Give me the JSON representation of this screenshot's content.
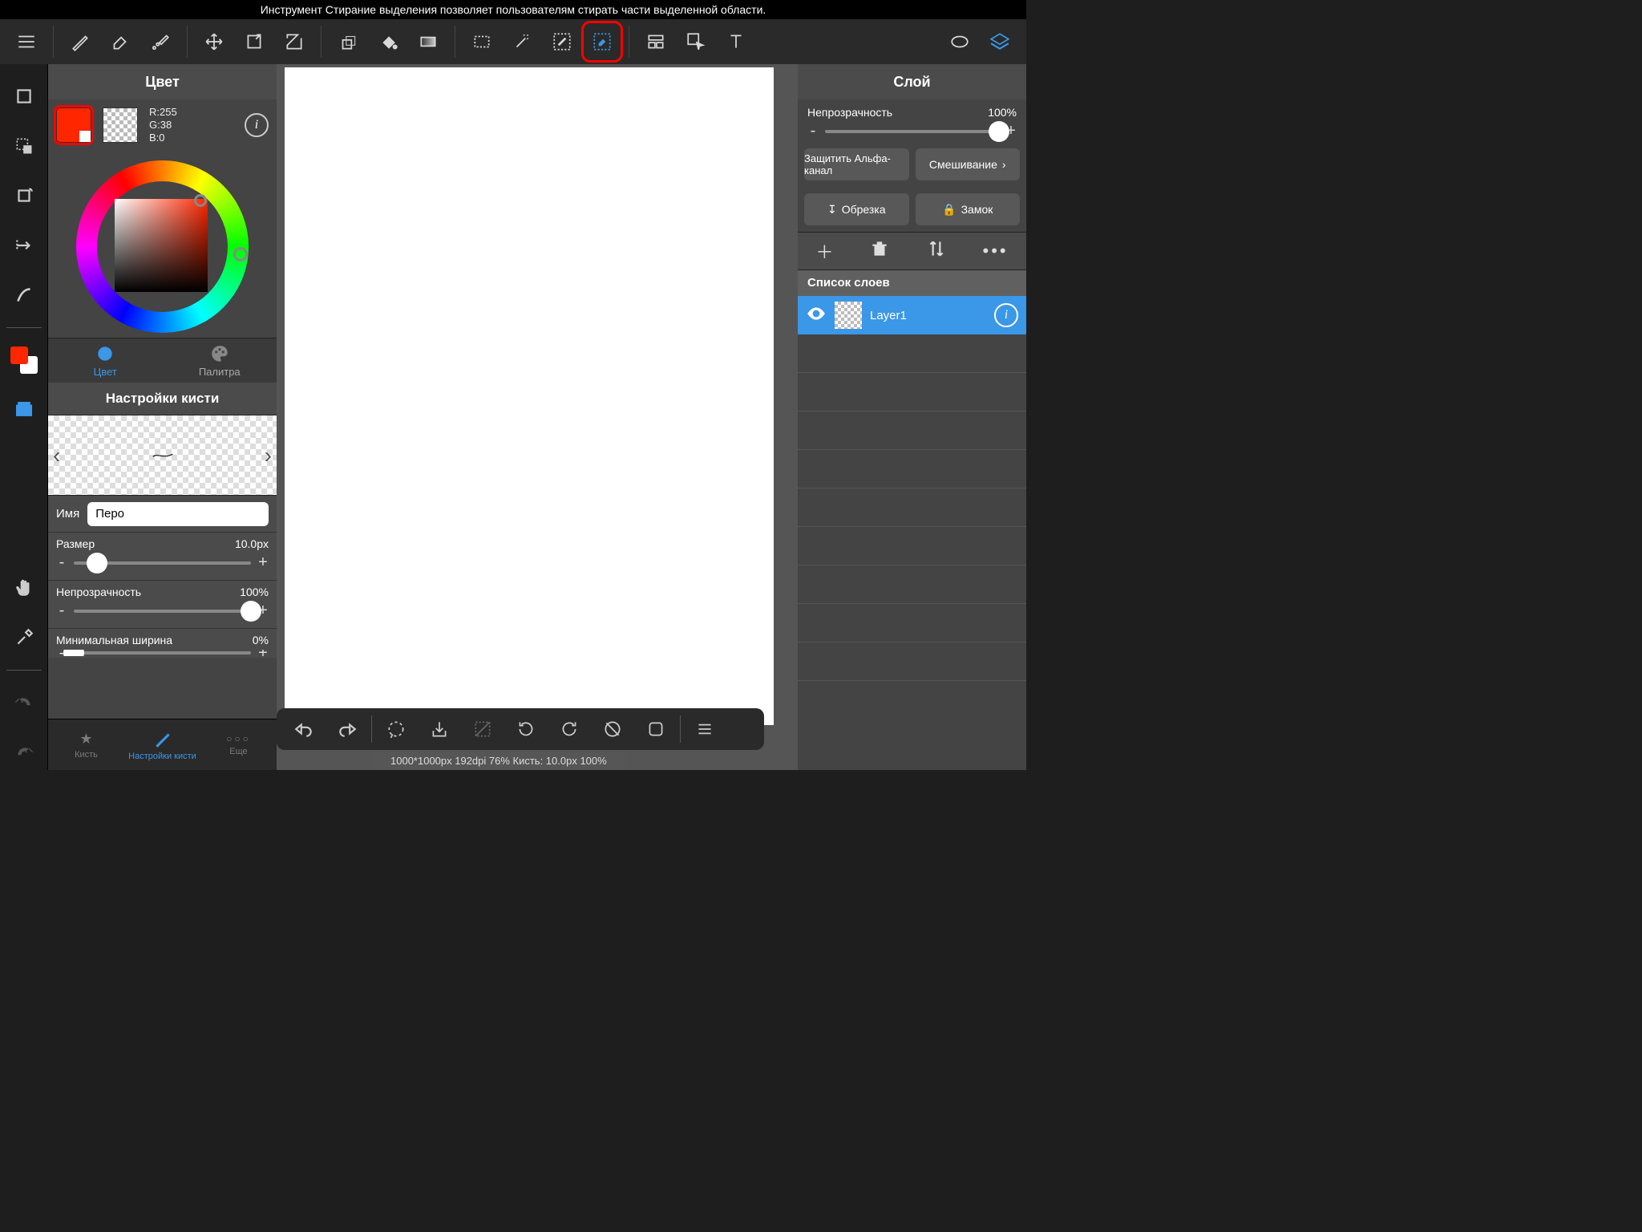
{
  "help_text": "Инструмент Стирание выделения позволяет пользователям стирать части выделенной области.",
  "color_panel": {
    "title": "Цвет",
    "rgb": {
      "r_label": "R:255",
      "g_label": "G:38",
      "b_label": "B:0"
    },
    "tabs": {
      "color": "Цвет",
      "palette": "Палитра"
    }
  },
  "brush_panel": {
    "title": "Настройки кисти",
    "name_label": "Имя",
    "name_value": "Перо",
    "size": {
      "label": "Размер",
      "value": "10.0px",
      "percent": 13
    },
    "opacity": {
      "label": "Непрозрачность",
      "value": "100%",
      "percent": 100
    },
    "min_width": {
      "label": "Минимальная ширина",
      "value": "0%",
      "percent": 0
    }
  },
  "bottom_tabs": {
    "brush": "Кисть",
    "settings": "Настройки кисти",
    "more": "Еще"
  },
  "layer_panel": {
    "title": "Слой",
    "opacity": {
      "label": "Непрозрачность",
      "value": "100%",
      "percent": 100
    },
    "protect_alpha": "Защитить Альфа-канал",
    "blending": "Смешивание",
    "crop": "Обрезка",
    "lock": "Замок",
    "list_header": "Список слоев",
    "layers": [
      {
        "name": "Layer1"
      }
    ]
  },
  "status_bar": "1000*1000px 192dpi 76% Кисть: 10.0px 100%"
}
